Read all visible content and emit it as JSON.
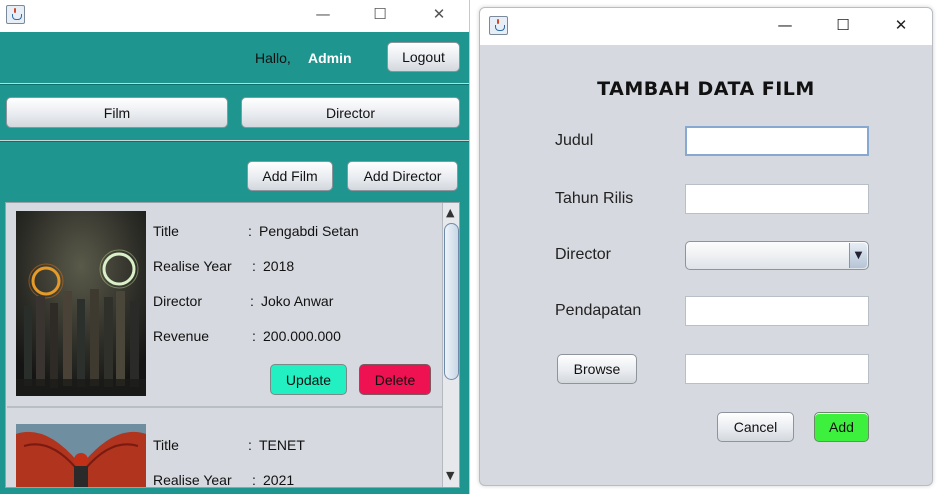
{
  "main_window": {
    "greeting": "Hallo,",
    "username": "Admin",
    "logout_label": "Logout",
    "nav": {
      "film_label": "Film",
      "director_label": "Director"
    },
    "actions": {
      "add_film_label": "Add Film",
      "add_director_label": "Add Director"
    },
    "field_labels": {
      "title": "Title",
      "year": "Realise Year",
      "director": "Director",
      "revenue": "Revenue",
      "colon": ":"
    },
    "films": [
      {
        "title": "Pengabdi Setan",
        "year": "2018",
        "director": "Joko Anwar",
        "revenue": "200.000.000",
        "update_label": "Update",
        "delete_label": "Delete"
      },
      {
        "title": "TENET",
        "year": "2021"
      }
    ],
    "colors": {
      "background": "#1e958f",
      "update": "#22f0c2",
      "delete": "#ef1252"
    }
  },
  "form_window": {
    "heading": "TAMBAH DATA FILM",
    "labels": {
      "judul": "Judul",
      "tahun": "Tahun Rilis",
      "director": "Director",
      "pendapatan": "Pendapatan"
    },
    "fields": {
      "judul": "",
      "tahun": "",
      "director": "",
      "pendapatan": "",
      "path": ""
    },
    "browse_label": "Browse",
    "cancel_label": "Cancel",
    "add_label": "Add",
    "colors": {
      "add": "#3ef03e"
    }
  },
  "icons": {
    "app": "java-icon",
    "minimize": "minimize-icon",
    "maximize": "maximize-icon",
    "close": "close-icon"
  }
}
